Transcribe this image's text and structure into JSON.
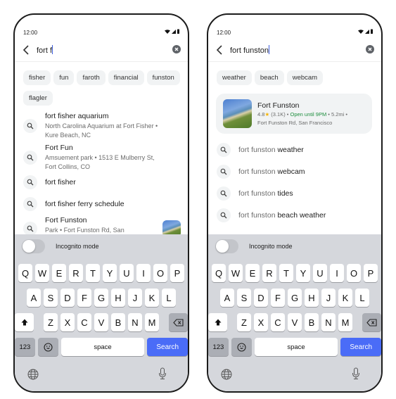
{
  "left": {
    "status": {
      "time": "12:00"
    },
    "search": {
      "query": "fort f"
    },
    "chips": [
      "fisher",
      "fun",
      "faroth",
      "financial",
      "funston",
      "flagler"
    ],
    "suggestions": [
      {
        "title": "fort fisher aquarium",
        "subtitle": "North Carolina Aquarium at Fort Fisher • Kure Beach, NC"
      },
      {
        "title": "Fort Fun",
        "subtitle": "Amsuement park • 1513 E Mulberry St, Fort Collins, CO"
      },
      {
        "title": "fort fisher"
      },
      {
        "title": "fort fisher ferry schedule"
      },
      {
        "title": "Fort Funston",
        "subtitle": "Park • Fort Funston Rd, San"
      }
    ],
    "incognito_label": "Incognito mode",
    "incognito_on": false
  },
  "right": {
    "status": {
      "time": "12:00"
    },
    "search": {
      "query": "fort funston"
    },
    "chips": [
      "weather",
      "beach",
      "webcam"
    ],
    "place_card": {
      "title": "Fort Funston",
      "rating": "4.8",
      "reviews": "(3.1K)",
      "hours": "Open until 9PM",
      "distance": "5.2mi",
      "address": "Fort Funston Rd, San Francisco"
    },
    "suggestions": [
      {
        "prefix": "fort funston",
        "suffix": "weather"
      },
      {
        "prefix": "fort funston",
        "suffix": "webcam"
      },
      {
        "prefix": "fort funston",
        "suffix": "tides"
      },
      {
        "prefix": "fort funston",
        "suffix": "beach weather"
      }
    ],
    "incognito_label": "Incognito mode",
    "incognito_on": false
  },
  "keyboard": {
    "row1": [
      "Q",
      "W",
      "E",
      "R",
      "T",
      "Y",
      "U",
      "I",
      "O",
      "P"
    ],
    "row2": [
      "A",
      "S",
      "D",
      "F",
      "G",
      "H",
      "J",
      "K",
      "L"
    ],
    "row3": [
      "Z",
      "X",
      "C",
      "V",
      "B",
      "N",
      "M"
    ],
    "num_label": "123",
    "space_label": "space",
    "search_label": "Search",
    "accent_color": "#4a6cf7"
  },
  "separator": " • ",
  "icons": {
    "back": "chevron-left-icon",
    "clear": "clear-circle-icon",
    "search": "magnifier-icon",
    "shift": "shift-arrow-icon",
    "backspace": "backspace-icon",
    "emoji": "emoji-icon",
    "globe": "globe-icon",
    "mic": "microphone-icon",
    "wifi": "wifi-icon",
    "signal": "signal-icon",
    "battery": "battery-icon",
    "star": "star-icon"
  }
}
